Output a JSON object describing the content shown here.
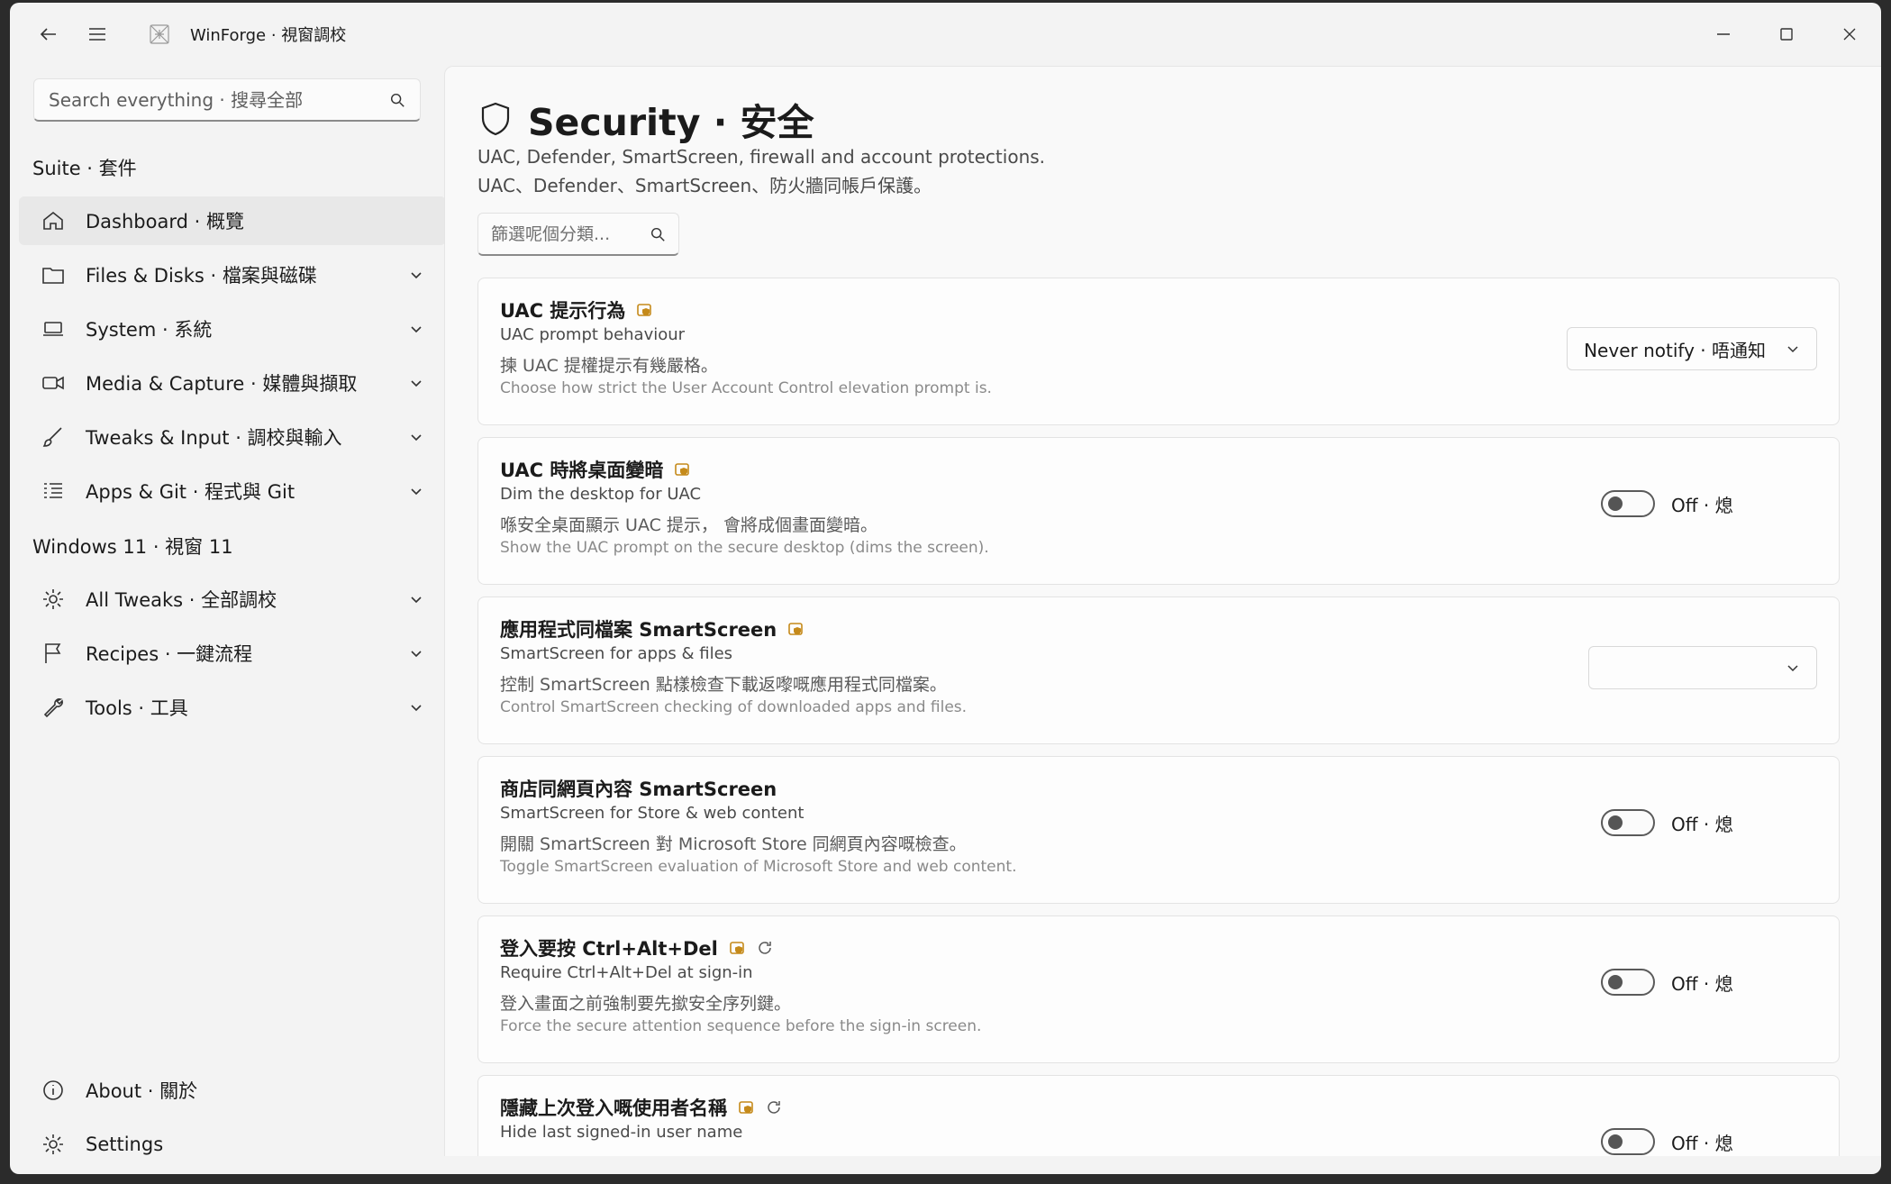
{
  "window": {
    "title": "WinForge · 視窗調校"
  },
  "sidebar": {
    "search_placeholder": "Search everything · 搜尋全部",
    "section_suite": "Suite · 套件",
    "section_windows": "Windows 11 · 視窗 11",
    "items": [
      {
        "label": "Dashboard · 概覽",
        "icon": "home-icon"
      },
      {
        "label": "Files & Disks · 檔案與磁碟",
        "icon": "folder-icon"
      },
      {
        "label": "System · 系統",
        "icon": "laptop-icon"
      },
      {
        "label": "Media & Capture · 媒體與擷取",
        "icon": "video-icon"
      },
      {
        "label": "Tweaks & Input · 調校與輸入",
        "icon": "brush-icon"
      },
      {
        "label": "Apps & Git · 程式與 Git",
        "icon": "list-icon"
      },
      {
        "label": "All Tweaks · 全部調校",
        "icon": "gear-icon"
      },
      {
        "label": "Recipes · 一鍵流程",
        "icon": "flag-icon"
      },
      {
        "label": "Tools · 工具",
        "icon": "wrench-icon"
      }
    ],
    "footer": [
      {
        "label": "About · 關於",
        "icon": "info-icon"
      },
      {
        "label": "Settings",
        "icon": "gear-icon"
      }
    ]
  },
  "page": {
    "title": "Security · 安全",
    "desc_en": "UAC, Defender, SmartScreen, firewall and account protections.",
    "desc_zh": "UAC、Defender、SmartScreen、防火牆同帳戶保護。",
    "filter_placeholder": "篩選呢個分類..."
  },
  "cards": [
    {
      "title": "UAC 提示行為",
      "subtitle": "UAC prompt behaviour",
      "desc_zh": "揀 UAC 提權提示有幾嚴格。",
      "desc_en": "Choose how strict the User Account Control elevation prompt is.",
      "control": "dropdown",
      "value": "Never notify · 唔通知"
    },
    {
      "title": "UAC 時將桌面變暗",
      "subtitle": "Dim the desktop for UAC",
      "desc_zh": "喺安全桌面顯示 UAC 提示， 會將成個畫面變暗。",
      "desc_en": "Show the UAC prompt on the secure desktop (dims the screen).",
      "control": "toggle",
      "value": "Off · 熄"
    },
    {
      "title": "應用程式同檔案 SmartScreen",
      "subtitle": "SmartScreen for apps & files",
      "desc_zh": "控制 SmartScreen 點樣檢查下載返嚟嘅應用程式同檔案。",
      "desc_en": "Control SmartScreen checking of downloaded apps and files.",
      "control": "dropdown-empty",
      "value": ""
    },
    {
      "title": "商店同網頁內容 SmartScreen",
      "subtitle": "SmartScreen for Store & web content",
      "desc_zh": "開關 SmartScreen 對 Microsoft Store 同網頁內容嘅檢查。",
      "desc_en": "Toggle SmartScreen evaluation of Microsoft Store and web content.",
      "control": "toggle",
      "value": "Off · 熄"
    },
    {
      "title": "登入要按 Ctrl+Alt+Del",
      "subtitle": "Require Ctrl+Alt+Del at sign-in",
      "desc_zh": "登入畫面之前強制要先撳安全序列鍵。",
      "desc_en": "Force the secure attention sequence before the sign-in screen.",
      "control": "toggle",
      "value": "Off · 熄",
      "refresh": true
    },
    {
      "title": "隱藏上次登入嘅使用者名稱",
      "subtitle": "Hide last signed-in user name",
      "desc_zh": "",
      "desc_en": "",
      "control": "toggle",
      "value": "Off · 熄",
      "refresh": true
    }
  ]
}
